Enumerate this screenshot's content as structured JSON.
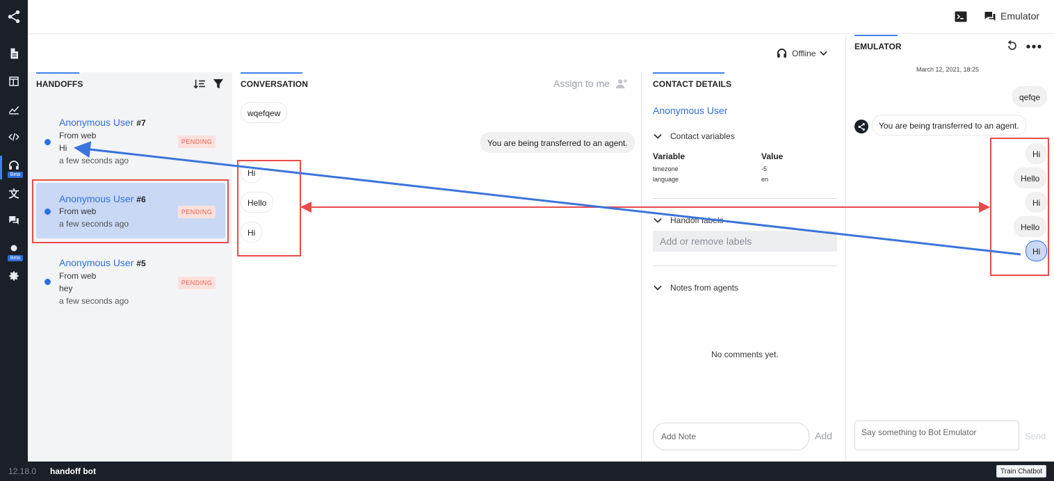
{
  "rail": {
    "icons": [
      "share-icon",
      "document-icon",
      "layout-icon",
      "analytics-icon",
      "code-icon",
      "headset-icon",
      "translate-icon",
      "chat-icon",
      "dot-icon",
      "settings-icon"
    ],
    "beta_label": "Beta"
  },
  "topbar": {
    "terminal_icon": "terminal-icon",
    "emulator_label": "Emulator"
  },
  "status": {
    "label": "Offline"
  },
  "handoffs": {
    "title": "HANDOFFS",
    "items": [
      {
        "name": "Anonymous User",
        "num": "#7",
        "source": "From web",
        "message": "Hi",
        "time": "a few seconds ago",
        "status": "PENDING"
      },
      {
        "name": "Anonymous User",
        "num": "#6",
        "source": "From web",
        "message": "",
        "time": "a few seconds ago",
        "status": "PENDING"
      },
      {
        "name": "Anonymous User",
        "num": "#5",
        "source": "From web",
        "message": "hey",
        "time": "a few seconds ago",
        "status": "PENDING"
      }
    ]
  },
  "conversation": {
    "title": "CONVERSATION",
    "assign_label": "Assign to me",
    "messages": [
      "wqefqew",
      "You are being transferred to an agent.",
      "Hi",
      "Hello",
      "Hi"
    ]
  },
  "contact": {
    "title": "CONTACT DETAILS",
    "user": "Anonymous User",
    "variables_section": "Contact variables",
    "var_header": "Variable",
    "value_header": "Value",
    "vars": [
      {
        "name": "timezone",
        "value": "-5"
      },
      {
        "name": "language",
        "value": "en"
      }
    ],
    "labels_section": "Handoff labels",
    "labels_placeholder": "Add or remove labels",
    "notes_section": "Notes from agents",
    "no_comments": "No comments yet.",
    "note_placeholder": "Add Note",
    "add_label": "Add"
  },
  "emulator": {
    "title": "EMULATOR",
    "date": "March 12, 2021, 18:25",
    "messages": [
      "qefqe",
      "You are being transferred to an agent.",
      "Hi",
      "Hello",
      "Hi",
      "Hello",
      "Hi"
    ],
    "input_placeholder": "Say something to Bot Emulator",
    "send_label": "Send"
  },
  "footer": {
    "version": "12.18.0",
    "bot_name": "handoff bot",
    "train_label": "Train Chatbot"
  },
  "colors": {
    "accent": "#2f6fde",
    "annotation_red": "#e84a4a",
    "annotation_blue": "#3a74dc",
    "rail_bg": "#1b2028"
  }
}
